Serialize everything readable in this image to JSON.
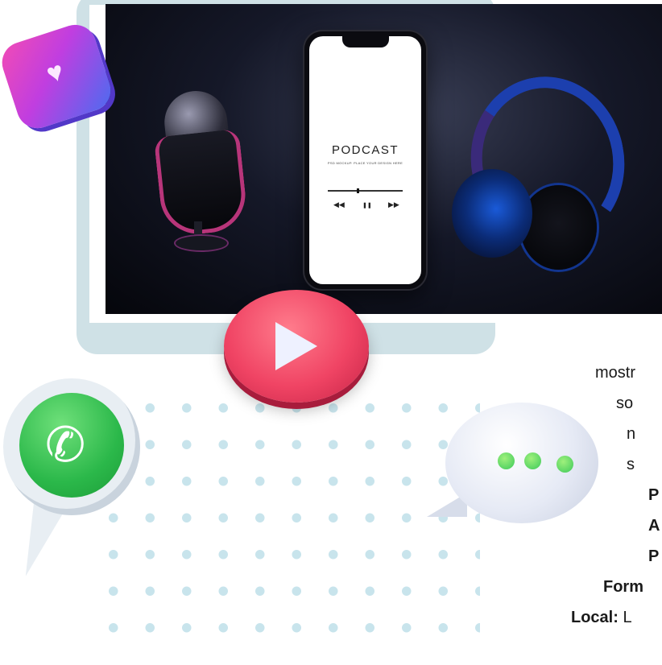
{
  "banner": {
    "phone": {
      "title": "PODCAST",
      "subtitle": "PSD MOCKUP. PLACE YOUR DESIGN HERE",
      "controls": {
        "rewind": "◀◀",
        "pause": "❚❚",
        "forward": "▶▶"
      }
    }
  },
  "icons": {
    "heart_badge": "heart-icon",
    "play_button": "play-icon",
    "whatsapp": "phone-icon",
    "chat": "chat-bubble-icon"
  },
  "text_lines": [
    {
      "text": "mostr",
      "bold": false
    },
    {
      "text": "so",
      "bold": false
    },
    {
      "text": "n",
      "bold": false
    },
    {
      "text": "s",
      "bold": false
    },
    {
      "text": "P",
      "bold": true
    },
    {
      "text": "A",
      "bold": true
    },
    {
      "text": "P",
      "bold": true
    },
    {
      "text": "Form",
      "bold": true
    },
    {
      "label": "Local:",
      "value": " L"
    }
  ],
  "colors": {
    "accent_play": "#f04464",
    "whatsapp_green": "#2bb84a",
    "dot_pattern": "#c8e4ec",
    "frame": "#cfe1e6"
  }
}
